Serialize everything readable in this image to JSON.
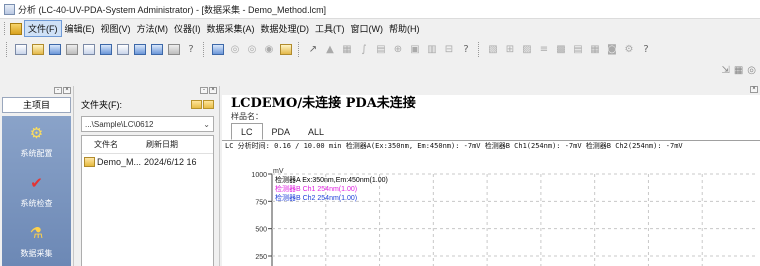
{
  "window": {
    "title": "分析 (LC-40-UV-PDA-System Administrator) - [数据采集 - Demo_Method.lcm]"
  },
  "menu": {
    "items": [
      "文件(F)",
      "编辑(E)",
      "视图(V)",
      "方法(M)",
      "仪器(I)",
      "数据采集(A)",
      "数据处理(D)",
      "工具(T)",
      "窗口(W)",
      "帮助(H)"
    ],
    "active_index": 0
  },
  "toolbar": {
    "icons": [
      "new-icon",
      "open-icon",
      "save-icon",
      "print-icon",
      "print-preview-icon",
      "view-icon",
      "layout-icon",
      "window-icon",
      "panel-icon",
      "chart-icon",
      "help-icon",
      "method-icon",
      "start-icon",
      "stop-icon",
      "pause-icon",
      "edit-icon",
      "cursor-icon",
      "peak-icon",
      "table-icon",
      "integrate-icon",
      "calc-icon",
      "zoom-icon",
      "tools-icon",
      "question-icon",
      "report-icon",
      "export-icon",
      "batch-icon",
      "print-report-icon",
      "db-icon",
      "queue-icon",
      "link-icon",
      "settings-icon",
      "help-icon-2"
    ],
    "secondary_icons": [
      "zoom-icon",
      "grid-icon",
      "settings-icon"
    ]
  },
  "left_panel": {
    "main_tab": "主项目",
    "nav_items": [
      {
        "label": "系统配置",
        "icon": "system-config-icon"
      },
      {
        "label": "系统检查",
        "icon": "system-check-icon"
      },
      {
        "label": "数据采集",
        "icon": "data-acquisition-icon"
      }
    ]
  },
  "file_panel": {
    "folder_label": "文件夹(F):",
    "path": "...\\Sample\\LC\\0612",
    "columns": [
      "文件名",
      "刷新日期"
    ],
    "rows": [
      {
        "name": "Demo_M...",
        "date": "2024/6/12 16"
      }
    ]
  },
  "content": {
    "status_title": "LCDEMO/未连接  PDA未连接",
    "sample_label": "样品名：",
    "tabs": [
      "LC",
      "PDA",
      "ALL"
    ],
    "active_tab": 0,
    "readout": "LC 分析时间: 0.16 / 10.00 min 检测器A(Ex:350nm, Em:450nm): -7mV 检测器B Ch1(254nm): -7mV 检测器B Ch2(254nm): -7mV"
  },
  "chart_data": {
    "type": "line",
    "ylabel": "mV",
    "y_ticks": [
      1000,
      750,
      500,
      250
    ],
    "ylim": [
      250,
      1000
    ],
    "grid": true,
    "series": [
      {
        "name": "检测器A Ex:350nm,Em:450nm(1.00)",
        "color": "#000000"
      },
      {
        "name": "检测器B Ch1 254nm(1.00)",
        "color": "#e020e0"
      },
      {
        "name": "检测器B Ch2 254nm(1.00)",
        "color": "#1f3fd8"
      }
    ],
    "legend_position": "top-left"
  }
}
